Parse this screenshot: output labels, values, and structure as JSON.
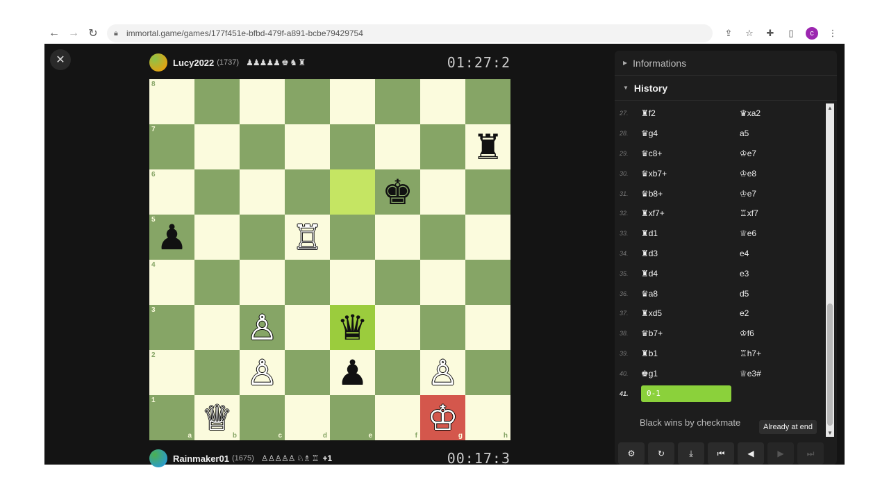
{
  "browser": {
    "url": "immortal.game/games/177f451e-bfbd-479f-a891-bcbe79429754",
    "profile_initial": "c"
  },
  "top_player": {
    "name": "Lucy2022",
    "rating": "(1737)",
    "captured": "♟♟♟♟♟ ♚ ♞ ♜",
    "clock": "01:27:2"
  },
  "bottom_player": {
    "name": "Rainmaker01",
    "rating": "(1675)",
    "captured": "♙♙♙♙♙ ♘♗ ♖",
    "advantage": "+1",
    "clock": "00:17:3"
  },
  "board": {
    "files": [
      "a",
      "b",
      "c",
      "d",
      "e",
      "f",
      "g",
      "h"
    ],
    "ranks": [
      "8",
      "7",
      "6",
      "5",
      "4",
      "3",
      "2",
      "1"
    ],
    "pieces": [
      {
        "square": "h7",
        "glyph": "♜",
        "color": "b"
      },
      {
        "square": "f6",
        "glyph": "♚",
        "color": "b"
      },
      {
        "square": "a5",
        "glyph": "♟",
        "color": "b"
      },
      {
        "square": "d5",
        "glyph": "♖",
        "color": "w"
      },
      {
        "square": "c3",
        "glyph": "♙",
        "color": "w"
      },
      {
        "square": "e3",
        "glyph": "♛",
        "color": "b"
      },
      {
        "square": "c2",
        "glyph": "♙",
        "color": "w"
      },
      {
        "square": "e2",
        "glyph": "♟",
        "color": "b"
      },
      {
        "square": "g2",
        "glyph": "♙",
        "color": "w"
      },
      {
        "square": "b1",
        "glyph": "♕",
        "color": "w"
      },
      {
        "square": "g1",
        "glyph": "♔",
        "color": "w"
      }
    ],
    "highlight_squares": [
      "e6",
      "e3"
    ],
    "check_square": "g1"
  },
  "panel": {
    "informations_label": "Informations",
    "history_label": "History",
    "moves": [
      {
        "num": "27.",
        "white": "♜f2",
        "black": "♛xa2"
      },
      {
        "num": "28.",
        "white": "♛g4",
        "black": "a5"
      },
      {
        "num": "29.",
        "white": "♛c8+",
        "black": "♔e7"
      },
      {
        "num": "30.",
        "white": "♛xb7+",
        "black": "♔e8"
      },
      {
        "num": "31.",
        "white": "♛b8+",
        "black": "♔e7"
      },
      {
        "num": "32.",
        "white": "♜xf7+",
        "black": "♖xf7"
      },
      {
        "num": "33.",
        "white": "♜d1",
        "black": "♕e6"
      },
      {
        "num": "34.",
        "white": "♜d3",
        "black": "e4"
      },
      {
        "num": "35.",
        "white": "♜d4",
        "black": "e3"
      },
      {
        "num": "36.",
        "white": "♛a8",
        "black": "d5"
      },
      {
        "num": "37.",
        "white": "♜xd5",
        "black": "e2"
      },
      {
        "num": "38.",
        "white": "♛b7+",
        "black": "♔f6"
      },
      {
        "num": "39.",
        "white": "♜b1",
        "black": "♖h7+"
      },
      {
        "num": "40.",
        "white": "♚g1",
        "black": "♕e3#"
      }
    ],
    "result_num": "41.",
    "result": "0-1",
    "status_text": "Black wins by checkmate",
    "tooltip": "Already at end"
  },
  "colors": {
    "light_square": "#fbfbdd",
    "dark_square": "#86a566",
    "highlight": "#c5e563",
    "check": "#d4574c",
    "result_pill": "#8bd13b"
  }
}
